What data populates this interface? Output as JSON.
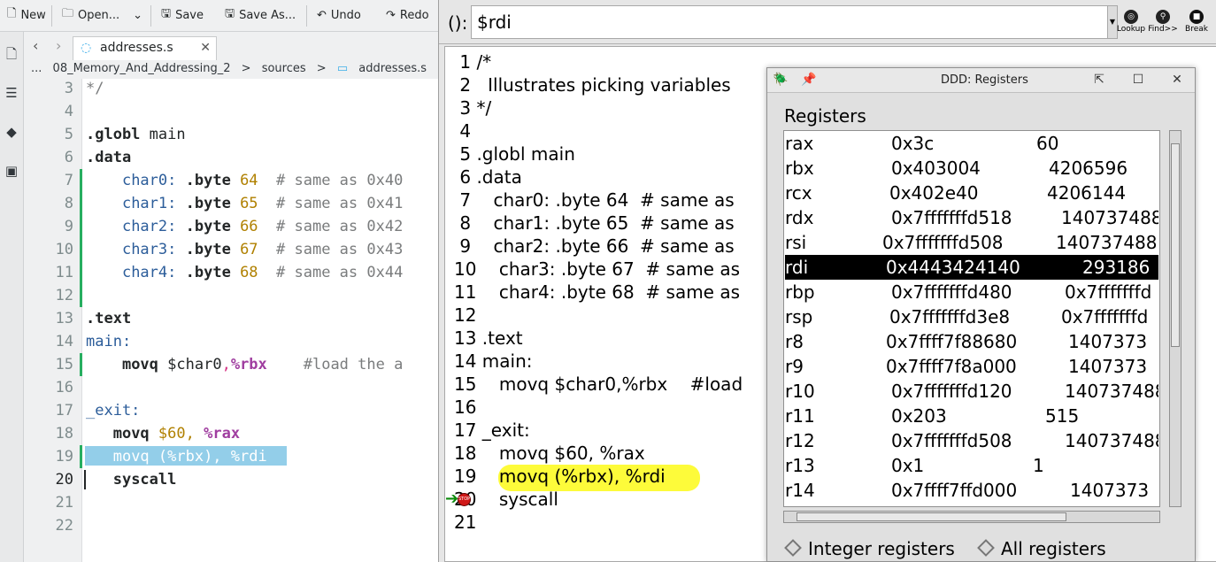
{
  "editor": {
    "toolbar": {
      "new": "New",
      "open": "Open...",
      "save": "Save",
      "save_as": "Save As...",
      "undo": "Undo",
      "redo": "Redo"
    },
    "tab": {
      "name": "addresses.s"
    },
    "breadcrumb": [
      "...",
      "08_Memory_And_Addressing_2",
      ">",
      "sources",
      ">",
      "addresses.s"
    ],
    "line_numbers": [
      "3",
      "4",
      "5",
      "6",
      "7",
      "8",
      "9",
      "10",
      "11",
      "12",
      "13",
      "14",
      "15",
      "16",
      "17",
      "18",
      "19",
      "20",
      "21",
      "22"
    ],
    "code": {
      "l3": "*/",
      "l5a": ".globl",
      "l5b": " main",
      "l6": ".data",
      "c0n": "char0:",
      "c1n": "char1:",
      "c2n": "char2:",
      "c3n": "char3:",
      "c4n": "char4:",
      "byte": ".byte",
      "v64": "64",
      "v65": "65",
      "v66": "66",
      "v67": "67",
      "v68": "68",
      "cm0": "# same as 0x40",
      "cm1": "# same as 0x41",
      "cm2": "# same as 0x42",
      "cm3": "# same as 0x43",
      "cm4": "# same as 0x44",
      "l13": ".text",
      "l14": "main:",
      "movq": "movq",
      "l15arg": "$char0",
      "comma": ",",
      "l15reg": "%rbx",
      "l15cm": "#load the a",
      "l17": "_exit:",
      "l18n": "$60,",
      "l18r": "%rax",
      "l19": "movq (%rbx), %rdi",
      "l20": "syscall"
    }
  },
  "ddd": {
    "arg_label": "():",
    "arg_value": "$rdi",
    "buttons": [
      {
        "label": "Lookup",
        "icon": "lookup-icon"
      },
      {
        "label": "Find>>",
        "icon": "find-icon"
      },
      {
        "label": "Break",
        "icon": "stop-icon"
      }
    ],
    "source_lines": [
      " 1 /*",
      " 2   Illustrates picking variables",
      " 3 */",
      " 4",
      " 5 .globl main",
      " 6 .data",
      " 7    char0: .byte 64  # same as",
      " 8    char1: .byte 65  # same as",
      " 9    char2: .byte 66  # same as",
      "10    char3: .byte 67  # same as",
      "11    char4: .byte 68  # same as",
      "12",
      "13 .text",
      "14 main:",
      "15    movq $char0,%rbx    #load",
      "16",
      "17 _exit:",
      "18    movq $60, %rax",
      "19    movq (%rbx), %rdi",
      "20    syscall",
      "21"
    ],
    "registers_window": {
      "title": "DDD: Registers",
      "heading": "Registers",
      "rows": [
        {
          "name": "rax",
          "hex": "0x3c",
          "dec": "60"
        },
        {
          "name": "rbx",
          "hex": "0x403004",
          "dec": "4206596"
        },
        {
          "name": "rcx",
          "hex": "0x402e40",
          "dec": "4206144"
        },
        {
          "name": "rdx",
          "hex": "0x7fffffffd518",
          "dec": "140737488"
        },
        {
          "name": "rsi",
          "hex": "0x7fffffffd508",
          "dec": "140737488"
        },
        {
          "name": "rdi",
          "hex": "0x4443424140",
          "dec": "293186"
        },
        {
          "name": "rbp",
          "hex": "0x7fffffffd480",
          "dec": "0x7fffffffd"
        },
        {
          "name": "rsp",
          "hex": "0x7fffffffd3e8",
          "dec": "0x7fffffffd"
        },
        {
          "name": "r8",
          "hex": "0x7ffff7f88680",
          "dec": "1407373"
        },
        {
          "name": "r9",
          "hex": "0x7ffff7f8a000",
          "dec": "1407373"
        },
        {
          "name": "r10",
          "hex": "0x7fffffffd120",
          "dec": "140737488"
        },
        {
          "name": "r11",
          "hex": "0x203",
          "dec": "515"
        },
        {
          "name": "r12",
          "hex": "0x7fffffffd508",
          "dec": "140737488"
        },
        {
          "name": "r13",
          "hex": "0x1",
          "dec": "1"
        },
        {
          "name": "r14",
          "hex": "0x7ffff7ffd000",
          "dec": "1407373"
        }
      ],
      "radio_integer": "Integer registers",
      "radio_all": "All registers"
    }
  }
}
